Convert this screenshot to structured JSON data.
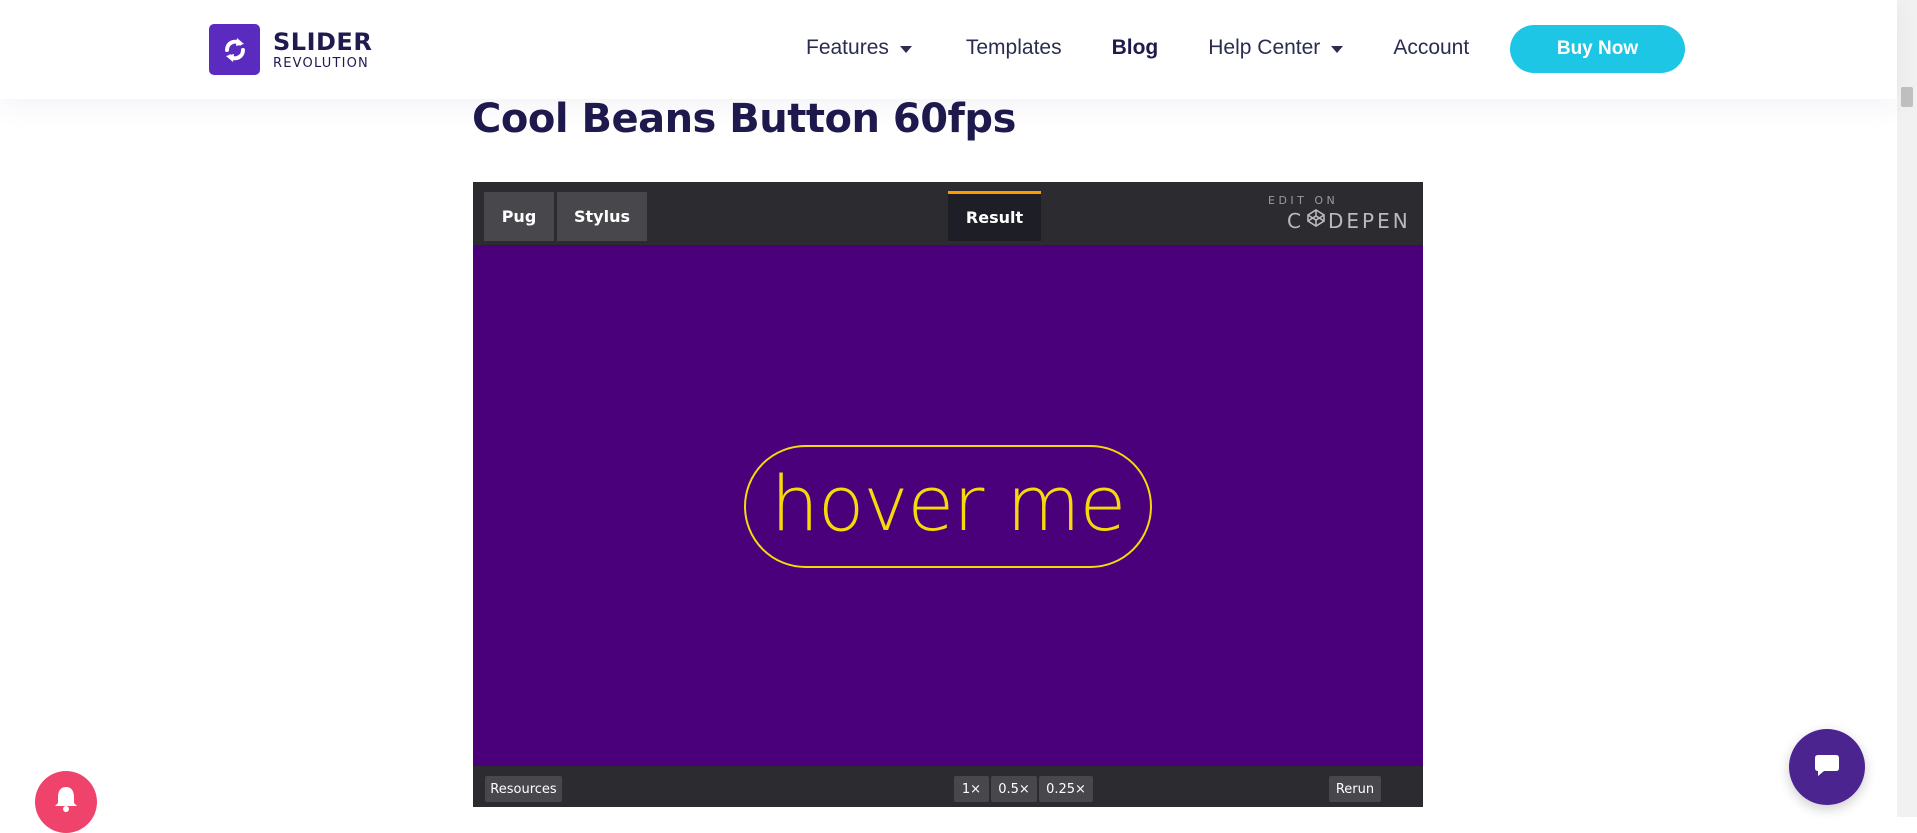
{
  "header": {
    "logo_title": "SLIDER",
    "logo_subtitle": "REVOLUTION",
    "nav": {
      "features": "Features",
      "templates": "Templates",
      "blog": "Blog",
      "help_center": "Help Center",
      "account": "Account"
    },
    "buy_now": "Buy Now",
    "brand_color": "#5b2bbf",
    "accent_color": "#1ec6e6"
  },
  "article": {
    "title": "Cool Beans Button 60fps"
  },
  "codepen": {
    "tabs": {
      "pug": "Pug",
      "stylus": "Stylus",
      "result": "Result"
    },
    "edit_on": "EDIT ON",
    "codepen_prefix": "C",
    "codepen_suffix": "DEPEN",
    "result_background": "#4a007a",
    "button_label": "hover me",
    "button_color": "#f5d90a",
    "bottom": {
      "resources": "Resources",
      "zoom_1x": "1×",
      "zoom_05x": "0.5×",
      "zoom_025x": "0.25×",
      "rerun": "Rerun"
    }
  },
  "widgets": {
    "notification_icon": "bell-icon",
    "chat_icon": "chat-bubble-icon"
  }
}
